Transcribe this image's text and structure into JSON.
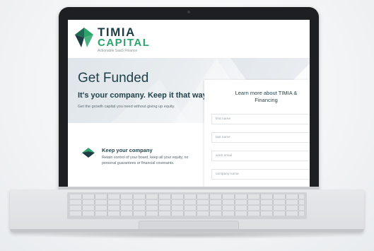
{
  "logo": {
    "line1": "TIMIA",
    "line2": "CAPITAL",
    "tagline": "Actionable SaaS Finance"
  },
  "hero": {
    "title": "Get Funded",
    "subtitle": "It's your company. Keep it that way.",
    "description": "Get the growth capital you need without giving up equity."
  },
  "features": [
    {
      "title": "Keep your company",
      "description": "Retain control of your board, keep all your equity, no personal guarantees or financial covenants.",
      "icon": "arrow-icon"
    }
  ],
  "form": {
    "title_line1": "Learn more about TIMIA &",
    "title_line2": "Financing",
    "fields": [
      {
        "placeholder": "first name"
      },
      {
        "placeholder": "last name"
      },
      {
        "placeholder": "work email"
      },
      {
        "placeholder": "company name"
      }
    ]
  },
  "colors": {
    "brand_dark": "#1e3c43",
    "brand_green": "#2aa56b"
  }
}
